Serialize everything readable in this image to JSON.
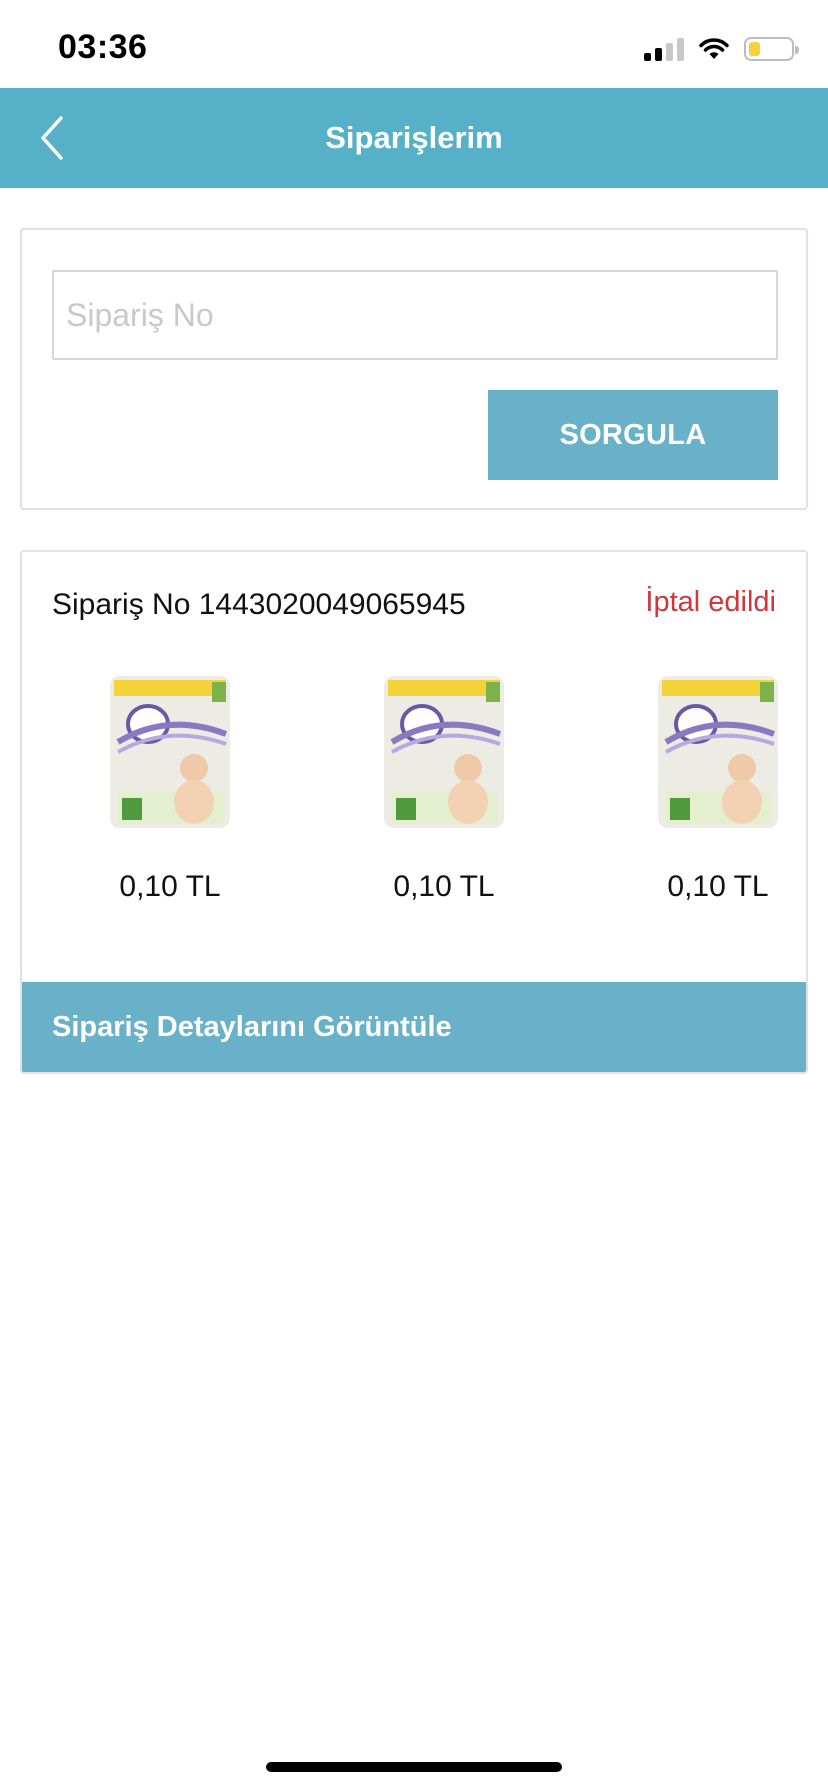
{
  "status_bar": {
    "time": "03:36"
  },
  "header": {
    "title": "Siparişlerim"
  },
  "search": {
    "placeholder": "Sipariş No",
    "value": "",
    "button_label": "SORGULA"
  },
  "order": {
    "number_label": "Sipariş No 1443020049065945",
    "status": "İptal edildi",
    "status_color": "#d0363a",
    "products": [
      {
        "price": "0,10 TL"
      },
      {
        "price": "0,10 TL"
      },
      {
        "price": "0,10 TL"
      }
    ],
    "details_button": "Sipariş Detaylarını Görüntüle"
  },
  "colors": {
    "header_bg": "#55b0c8",
    "button_bg": "#68b1c8"
  }
}
